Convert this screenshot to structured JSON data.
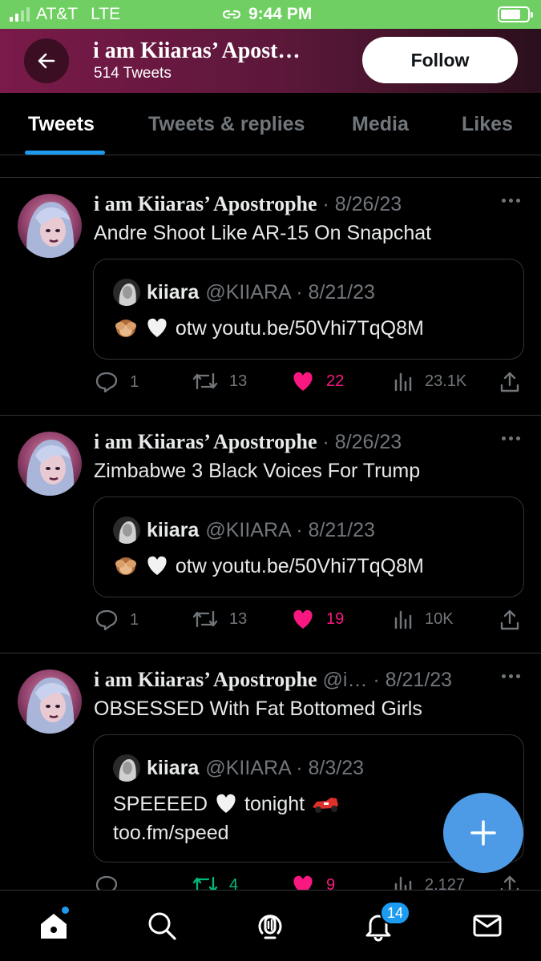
{
  "status_bar": {
    "carrier": "AT&T",
    "network": "LTE",
    "time": "9:44 PM"
  },
  "header": {
    "title": "i am Kiiaras’ Apost…",
    "subtitle": "514 Tweets",
    "follow_label": "Follow"
  },
  "tabs": [
    {
      "label": "Tweets",
      "active": true
    },
    {
      "label": "Tweets & replies",
      "active": false
    },
    {
      "label": "Media",
      "active": false
    },
    {
      "label": "Likes",
      "active": false
    }
  ],
  "tweets": [
    {
      "name": "i am Kiiaras’ Apostrophe",
      "meta": "· 8/26/23",
      "text": "Andre Shoot Like AR-15 On Snapchat",
      "quote": {
        "name": "kiiara",
        "meta": "@KIIARA · 8/21/23",
        "line1": "otw youtu.be/50Vhi7TqQ8M"
      },
      "actions": {
        "replies": "1",
        "retweets": "13",
        "likes": "22",
        "views": "23.1K"
      }
    },
    {
      "name": "i am Kiiaras’ Apostrophe",
      "meta": "· 8/26/23",
      "text": "Zimbabwe 3 Black Voices For Trump",
      "quote": {
        "name": "kiiara",
        "meta": "@KIIARA · 8/21/23",
        "line1": "otw youtu.be/50Vhi7TqQ8M"
      },
      "actions": {
        "replies": "1",
        "retweets": "13",
        "likes": "19",
        "views": "10K"
      }
    },
    {
      "name": "i am Kiiaras’ Apostrophe",
      "meta": "@i… · 8/21/23",
      "text": "OBSESSED With Fat Bottomed Girls",
      "quote": {
        "name": "kiiara",
        "meta": "@KIIARA · 8/3/23",
        "line1a": "SPEEEED",
        "line1b": "tonight",
        "line2": "too.fm/speed"
      },
      "actions": {
        "replies": "",
        "retweets": "4",
        "likes": "9",
        "views": "2,127"
      }
    }
  ],
  "bottom_nav": {
    "notifications_badge": "14"
  },
  "colors": {
    "accent": "#1d9bf0",
    "like": "#f91880",
    "retweet": "#00ba7c",
    "status_bar": "#6fcf62"
  }
}
